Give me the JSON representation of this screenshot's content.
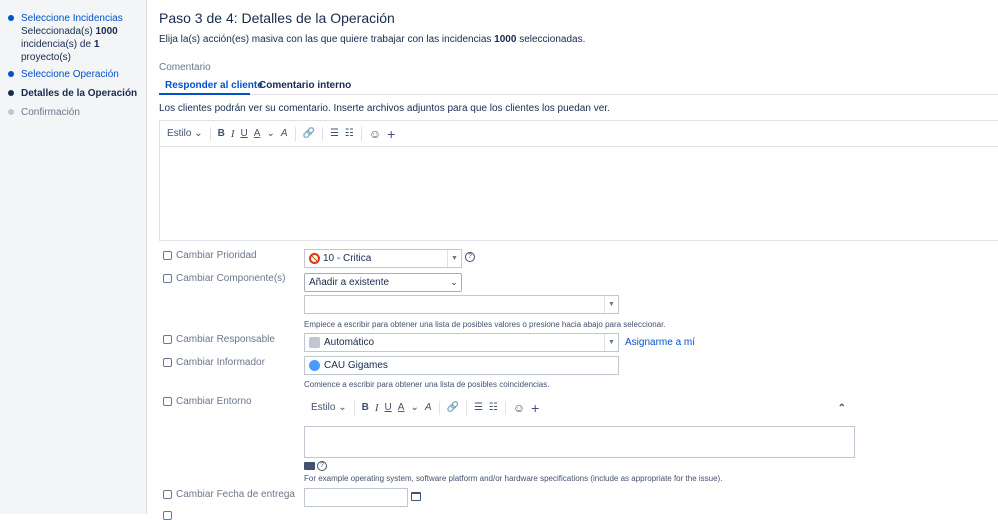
{
  "sidebar": {
    "steps": [
      {
        "label": "Seleccione Incidencias",
        "state": "done"
      },
      {
        "label": "Seleccione Operación",
        "state": "done"
      },
      {
        "label": "Detalles de la Operación",
        "state": "current"
      },
      {
        "label": "Confirmación",
        "state": "pending"
      }
    ],
    "summary": {
      "line1_prefix": "Seleccionada(s)",
      "line1_count": "1000",
      "line2_prefix": "incidencia(s) de",
      "line2_count": "1",
      "line3": "proyecto(s)"
    }
  },
  "main": {
    "title": "Paso 3 de 4: Detalles de la Operación",
    "intro_prefix": "Elija la(s) acción(es) masiva con las que quiere trabajar con las incidencias",
    "intro_count": "1000",
    "intro_suffix": "seleccionadas.",
    "comment_label": "Comentario",
    "tabs": [
      {
        "label": "Responder al cliente",
        "active": true
      },
      {
        "label": "Comentario interno",
        "active": false
      }
    ],
    "tab_help": "Los clientes podrán ver su comentario. Inserte archivos adjuntos para que los clientes los puedan ver.",
    "toolbar": {
      "style_label": "Estilo",
      "bold": "B",
      "italic": "I",
      "underline": "U",
      "text_color": "A",
      "caret": "⌄",
      "more_format": "A",
      "link": "🔗",
      "bullet_list": "☰",
      "numbered_list": "☷",
      "emoji": "☺",
      "insert": "+",
      "collapse": "⌃"
    },
    "fields": {
      "priority": {
        "label": "Cambiar Prioridad",
        "value": "10 - Critica",
        "help": "?"
      },
      "component": {
        "label": "Cambiar Componente(s)",
        "mode": "Añadir a existente",
        "value": "",
        "hint": "Empiece a escribir para obtener una lista de posibles valores o presione hacia abajo para seleccionar."
      },
      "assignee": {
        "label": "Cambiar Responsable",
        "value": "Automático",
        "assign_me": "Asignarme a mí"
      },
      "reporter": {
        "label": "Cambiar Informador",
        "value": "CAU Gigames",
        "hint": "Comience a escribir para obtener una lista de posibles coincidencias."
      },
      "environment": {
        "label": "Cambiar Entorno",
        "hint": "For example operating system, software platform and/or hardware specifications (include as appropriate for the issue).",
        "help": "?"
      },
      "due_date": {
        "label": "Cambiar Fecha de entrega",
        "value": ""
      }
    }
  },
  "colors": {
    "accent": "#0052cc",
    "text": "#172b4d",
    "muted": "#6b778c",
    "sidebar_bg": "#f4f5f7",
    "critical": "#de350b"
  }
}
